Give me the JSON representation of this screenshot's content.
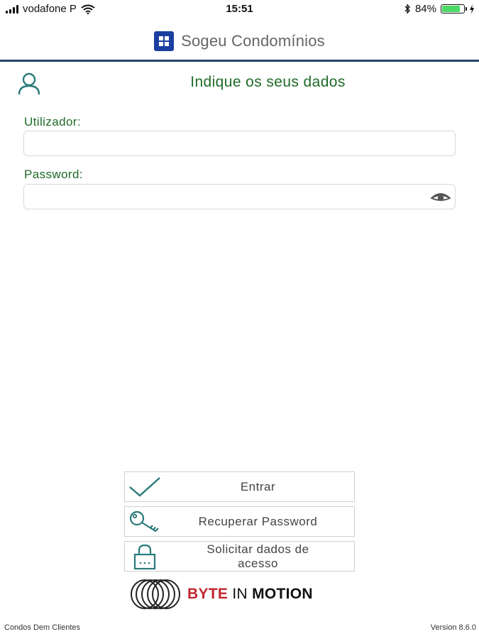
{
  "status_bar": {
    "carrier": "vodafone P",
    "time": "15:51",
    "battery_percent": "84%",
    "battery_level": 0.84
  },
  "header": {
    "app_title": "Sogeu Condomínios",
    "logo_color": "#1a3fa0",
    "rule_color": "#26426e"
  },
  "form": {
    "heading": "Indique os seus dados",
    "username_label": "Utilizador:",
    "username_value": "",
    "password_label": "Password:",
    "password_value": "",
    "accent_color": "#1f6b28"
  },
  "actions": {
    "login_label": "Entrar",
    "recover_label": "Recuperar Password",
    "request_label_line1": "Solicitar dados de",
    "request_label_line2": "acesso",
    "icon_color": "#2a7a7a"
  },
  "brand": {
    "byte": "BYTE",
    "in": "IN",
    "motion": "MOTION"
  },
  "footer": {
    "left": "Condos Dem Clientes",
    "version": "Version 8.6.0"
  },
  "icons": [
    "wifi-icon",
    "bluetooth-icon",
    "charging-icon",
    "user-icon",
    "eye-icon",
    "checkmark-icon",
    "key-icon",
    "lock-icon"
  ]
}
